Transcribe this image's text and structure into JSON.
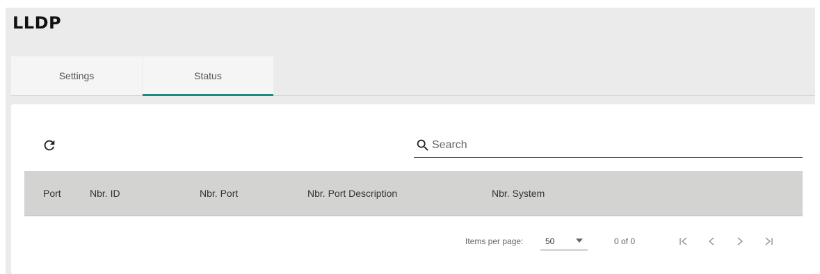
{
  "page": {
    "title": "LLDP"
  },
  "tabs": [
    {
      "label": "Settings",
      "active": false
    },
    {
      "label": "Status",
      "active": true
    }
  ],
  "toolbar": {
    "refresh_icon": "refresh-icon"
  },
  "search": {
    "placeholder": "Search",
    "value": ""
  },
  "table": {
    "columns": [
      "Port",
      "Nbr. ID",
      "Nbr. Port",
      "Nbr. Port Description",
      "Nbr. System"
    ],
    "rows": []
  },
  "paginator": {
    "items_per_page_label": "Items per page:",
    "items_per_page": "50",
    "range_label": "0 of 0"
  },
  "colors": {
    "accent": "#1a8a7a",
    "background": "#ebebeb",
    "table_header": "#d3d3d1"
  }
}
